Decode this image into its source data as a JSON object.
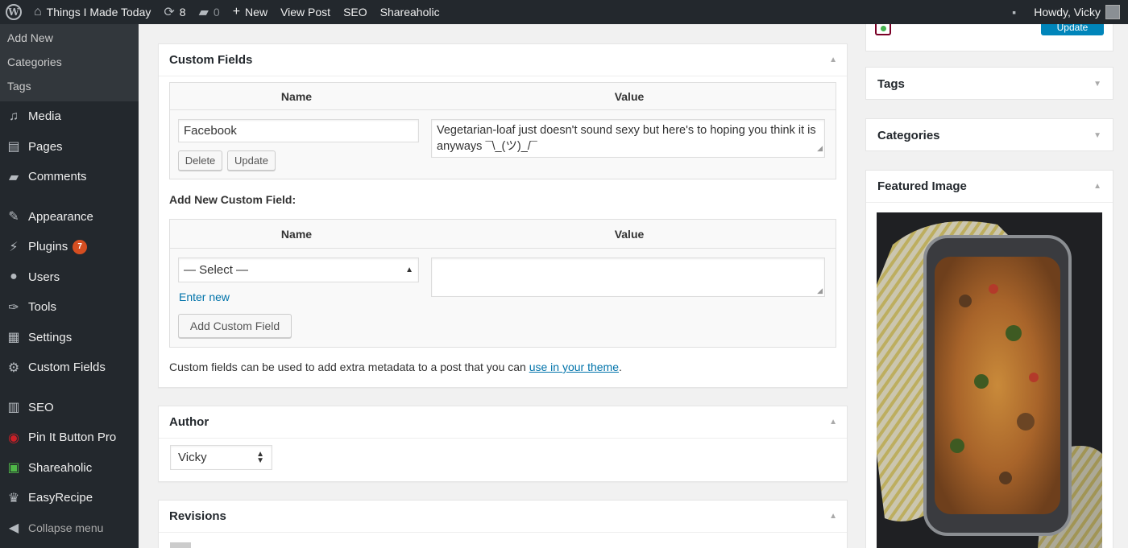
{
  "adminbar": {
    "site_name": "Things I Made Today",
    "updates_count": "8",
    "comments_count": "0",
    "new_label": "New",
    "view_post": "View Post",
    "seo": "SEO",
    "shareaholic": "Shareaholic",
    "howdy": "Howdy, Vicky"
  },
  "sidebar": {
    "submenu": [
      "Add New",
      "Categories",
      "Tags"
    ],
    "items": [
      {
        "label": "Media",
        "icon": "media-icon"
      },
      {
        "label": "Pages",
        "icon": "pages-icon"
      },
      {
        "label": "Comments",
        "icon": "comments-icon"
      },
      {
        "label": "Appearance",
        "icon": "appearance-icon"
      },
      {
        "label": "Plugins",
        "icon": "plugins-icon",
        "badge": "7"
      },
      {
        "label": "Users",
        "icon": "users-icon"
      },
      {
        "label": "Tools",
        "icon": "tools-icon"
      },
      {
        "label": "Settings",
        "icon": "settings-icon"
      },
      {
        "label": "Custom Fields",
        "icon": "custom-fields-icon"
      },
      {
        "label": "SEO",
        "icon": "seo-icon"
      },
      {
        "label": "Pin It Button Pro",
        "icon": "pinterest-icon"
      },
      {
        "label": "Shareaholic",
        "icon": "shareaholic-icon"
      },
      {
        "label": "EasyRecipe",
        "icon": "easyrecipe-icon"
      }
    ],
    "collapse": "Collapse menu",
    "badge_color": "#d54e21"
  },
  "custom_fields": {
    "title": "Custom Fields",
    "col_name": "Name",
    "col_value": "Value",
    "existing": {
      "name": "Facebook",
      "value": "Vegetarian-loaf just doesn't sound sexy but here's to hoping you think it is anyways ¯\\_(ツ)_/¯",
      "delete": "Delete",
      "update": "Update"
    },
    "add_new_heading": "Add New Custom Field:",
    "new_field": {
      "select_value": "— Select —",
      "enter_new": "Enter new",
      "add_button": "Add Custom Field"
    },
    "help_text": "Custom fields can be used to add extra metadata to a post that you can",
    "help_link": "use in your theme",
    "help_end": "."
  },
  "author": {
    "title": "Author",
    "selected": "Vicky"
  },
  "revisions": {
    "title": "Revisions"
  },
  "right": {
    "update_button": "Update",
    "tags": "Tags",
    "categories": "Categories",
    "featured_image": "Featured Image"
  },
  "colors": {
    "adminbar_bg": "#23282d",
    "link": "#0073aa",
    "primary_button": "#0085ba"
  }
}
